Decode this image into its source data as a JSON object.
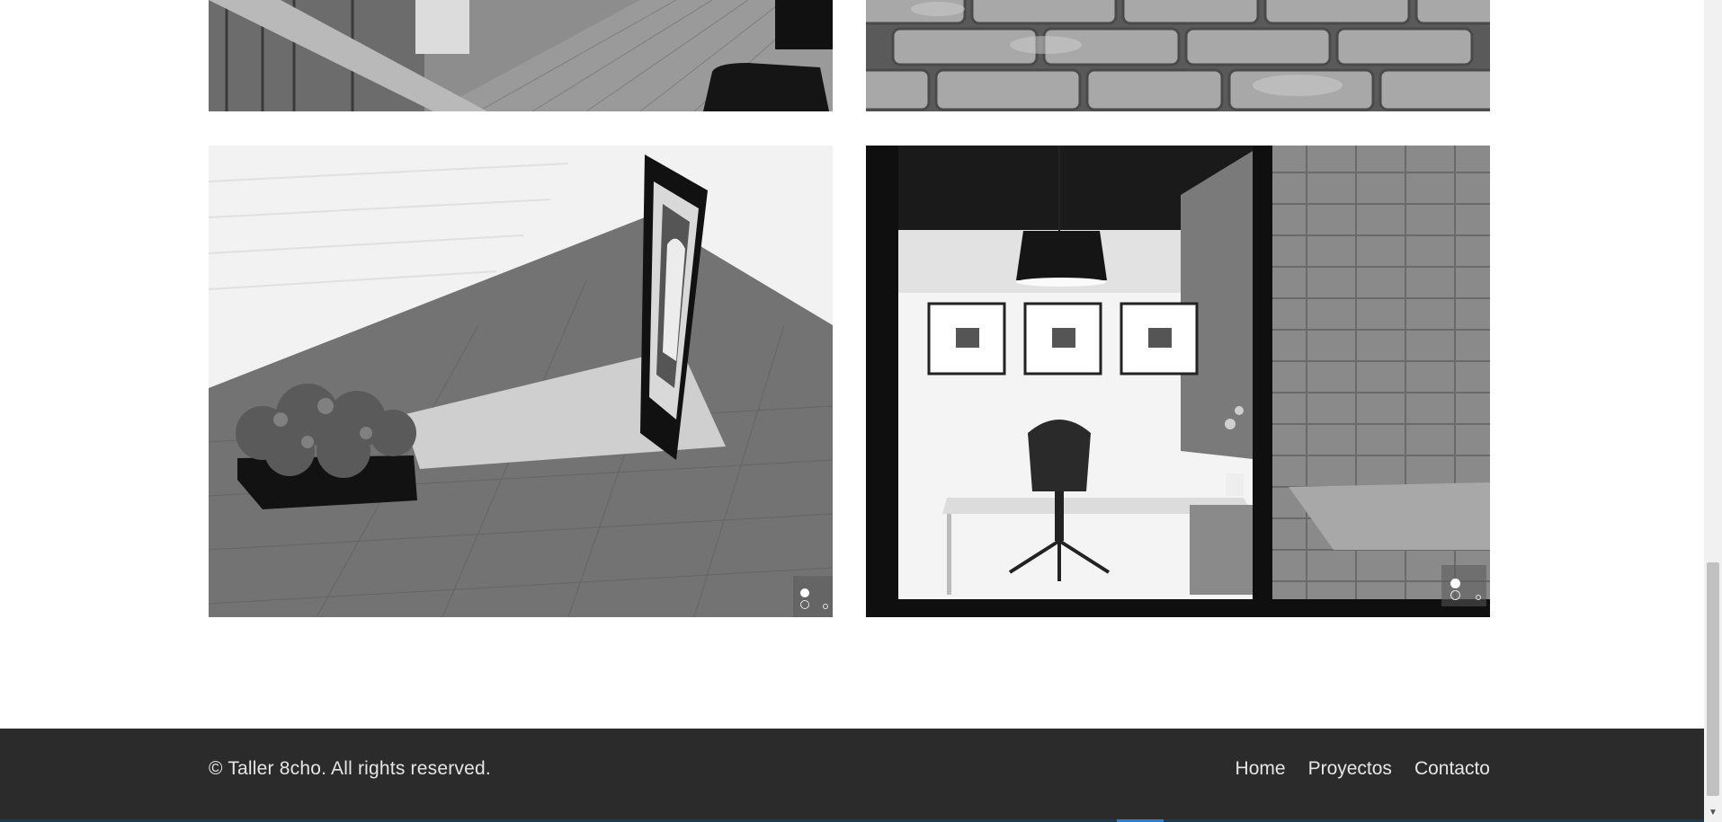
{
  "gallery": {
    "images": [
      {
        "name": "stairs-interior-photo",
        "description_icon": "image-icon"
      },
      {
        "name": "brick-wall-photo",
        "description_icon": "image-icon"
      },
      {
        "name": "planter-bench-photo",
        "description_icon": "image-icon"
      },
      {
        "name": "office-interior-photo",
        "description_icon": "image-icon"
      }
    ],
    "slider_indicators": {
      "count": 3,
      "active_index": 0
    }
  },
  "footer": {
    "copyright": "© Taller 8cho. All rights reserved.",
    "nav": [
      {
        "label": "Home"
      },
      {
        "label": "Proyectos"
      },
      {
        "label": "Contacto"
      }
    ]
  },
  "colors": {
    "footer_bg": "#2b2b2b",
    "footer_text": "#e6e6e6",
    "accent_line": "#1d3a4f",
    "accent_highlight": "#2f7fd0"
  }
}
